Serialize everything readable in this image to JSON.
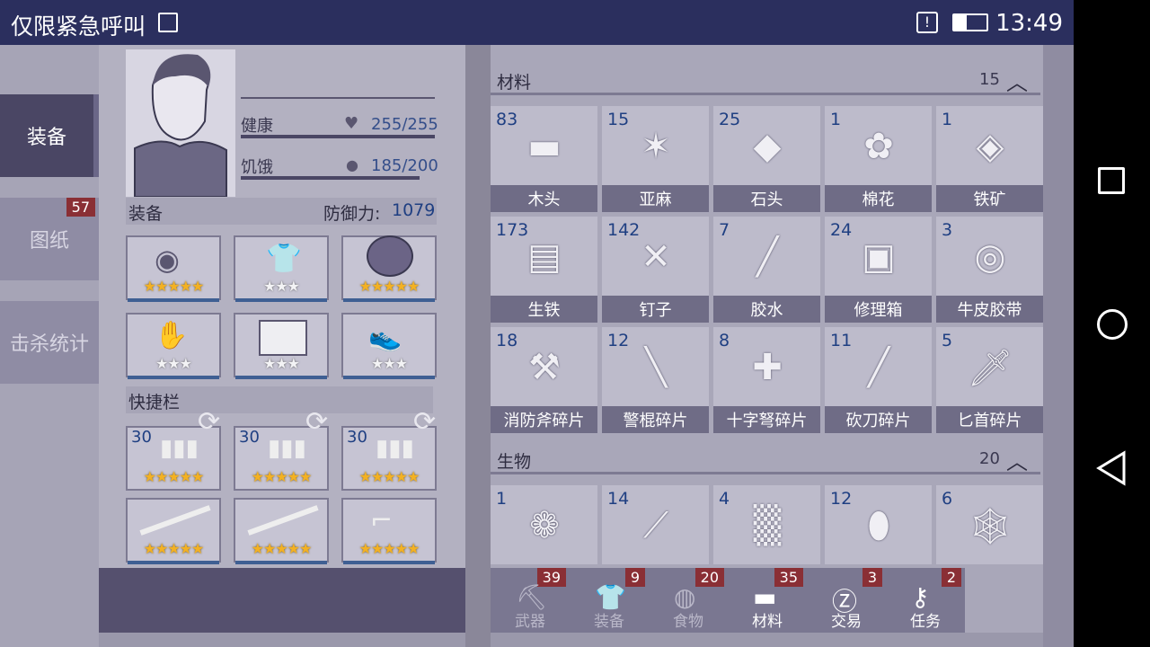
{
  "status_bar": {
    "title": "仅限紧急呼叫",
    "time": "13:49"
  },
  "tabs": [
    {
      "label": "装备"
    },
    {
      "label": "图纸",
      "badge": "57"
    },
    {
      "label": "击杀统计"
    }
  ],
  "character": {
    "health_label": "健康",
    "health_value": "255/255",
    "hunger_label": "饥饿",
    "hunger_value": "185/200"
  },
  "equipment": {
    "title": "装备",
    "defense_label": "防御力:",
    "defense_value": "1079",
    "slots": [
      {
        "icon": "hat-icon",
        "stars": "★★★★★",
        "grey": false
      },
      {
        "icon": "shirt-icon",
        "stars": "★★★",
        "grey": true
      },
      {
        "icon": "turtle-shell-armor-icon",
        "stars": "★★★★★",
        "grey": false
      },
      {
        "icon": "gloves-icon",
        "stars": "★★★",
        "grey": true
      },
      {
        "icon": "shorts-icon",
        "stars": "★★★",
        "grey": true
      },
      {
        "icon": "shoes-icon",
        "stars": "★★★",
        "grey": true
      }
    ]
  },
  "hotbar": {
    "title": "快捷栏",
    "ammo": [
      {
        "count": "30",
        "stars": "★★★★★"
      },
      {
        "count": "30",
        "stars": "★★★★★"
      },
      {
        "count": "30",
        "stars": "★★★★★"
      }
    ],
    "weapons": [
      {
        "icon": "shotgun-icon",
        "stars": "★★★★★"
      },
      {
        "icon": "rifle-icon",
        "stars": "★★★★★"
      },
      {
        "icon": "revolver-icon",
        "stars": "★★★★★"
      }
    ]
  },
  "materials": {
    "title": "材料",
    "count": "15",
    "items": [
      {
        "count": "83",
        "label": "木头"
      },
      {
        "count": "15",
        "label": "亚麻"
      },
      {
        "count": "25",
        "label": "石头"
      },
      {
        "count": "1",
        "label": "棉花"
      },
      {
        "count": "1",
        "label": "铁矿"
      },
      {
        "count": "173",
        "label": "生铁"
      },
      {
        "count": "142",
        "label": "钉子"
      },
      {
        "count": "7",
        "label": "胶水"
      },
      {
        "count": "24",
        "label": "修理箱"
      },
      {
        "count": "3",
        "label": "牛皮胶带"
      },
      {
        "count": "18",
        "label": "消防斧碎片"
      },
      {
        "count": "12",
        "label": "警棍碎片"
      },
      {
        "count": "8",
        "label": "十字弩碎片"
      },
      {
        "count": "11",
        "label": "砍刀碎片"
      },
      {
        "count": "5",
        "label": "匕首碎片"
      }
    ]
  },
  "creatures": {
    "title": "生物",
    "count": "20",
    "items": [
      {
        "count": "1"
      },
      {
        "count": "14"
      },
      {
        "count": "4"
      },
      {
        "count": "12"
      },
      {
        "count": "6"
      }
    ]
  },
  "bottom_tabs": [
    {
      "label": "武器",
      "badge": "39"
    },
    {
      "label": "装备",
      "badge": "9"
    },
    {
      "label": "食物",
      "badge": "20"
    },
    {
      "label": "材料",
      "badge": "35"
    },
    {
      "label": "交易",
      "badge": "3"
    },
    {
      "label": "任务",
      "badge": "2"
    }
  ]
}
